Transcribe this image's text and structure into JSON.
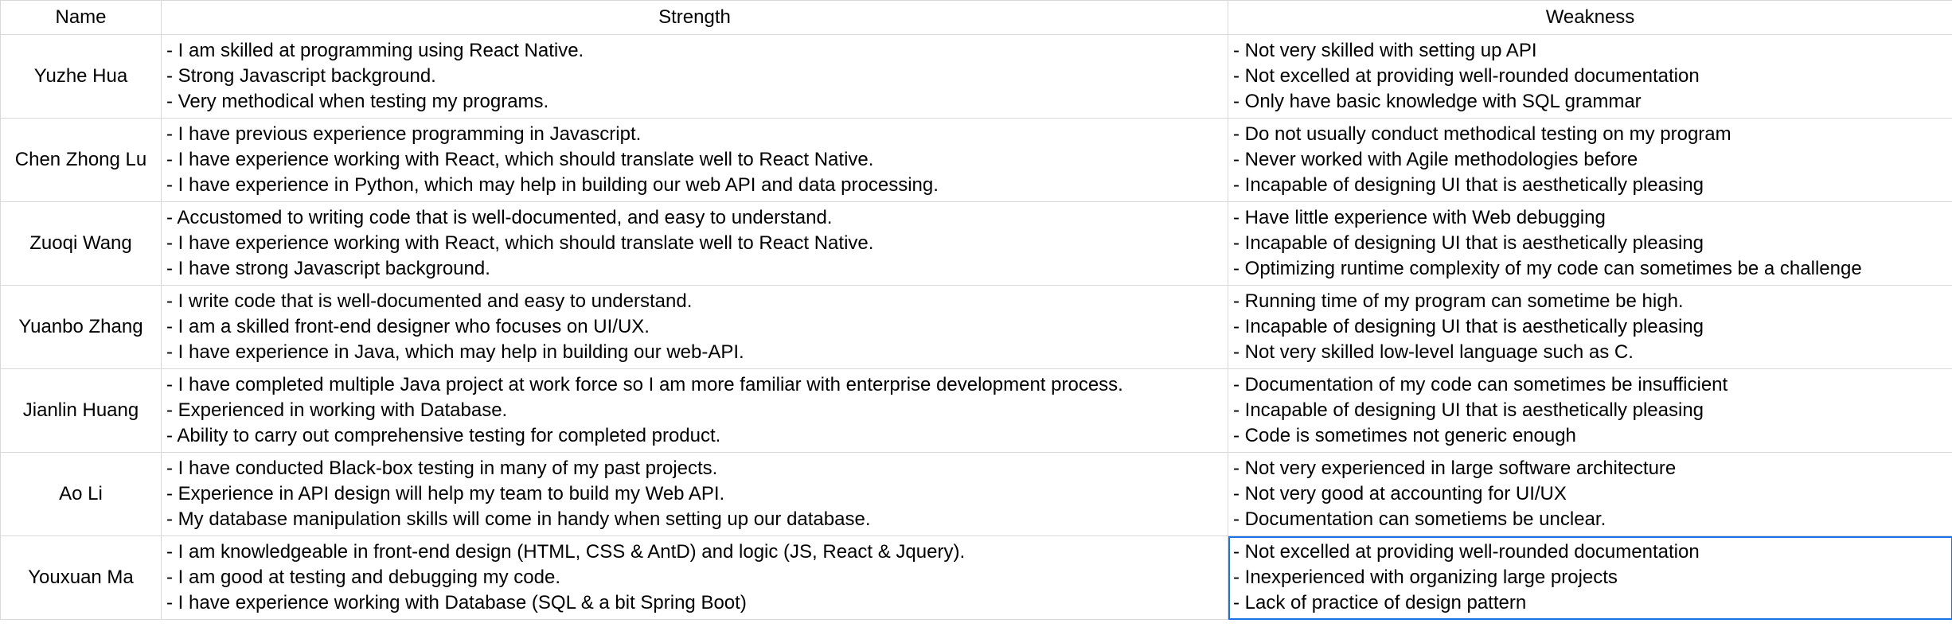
{
  "header": {
    "name": "Name",
    "strength": "Strength",
    "weakness": "Weakness"
  },
  "rows": [
    {
      "name": "Yuzhe Hua",
      "strength": [
        "- I am skilled at programming using React Native.",
        "- Strong Javascript background.",
        "- Very methodical when testing my programs."
      ],
      "weakness": [
        "- Not very skilled with setting up API",
        "- Not excelled at providing well-rounded documentation",
        "- Only have basic knowledge with SQL grammar"
      ]
    },
    {
      "name": "Chen Zhong Lu",
      "strength": [
        "- I have previous experience programming in Javascript.",
        "- I have experience working with React, which should translate well to React Native.",
        "- I have experience in Python, which may help in building our web API and data processing."
      ],
      "weakness": [
        "- Do not usually conduct methodical testing on my program",
        "- Never worked with Agile methodologies before",
        "- Incapable of designing UI that is aesthetically pleasing"
      ]
    },
    {
      "name": "Zuoqi Wang",
      "strength": [
        "- Accustomed to writing code that is well-documented, and easy to understand.",
        "- I have experience working with React, which should translate well to React Native.",
        "- I have strong Javascript background."
      ],
      "weakness": [
        "- Have little experience with Web debugging",
        "- Incapable of designing UI that is aesthetically pleasing",
        "- Optimizing runtime complexity of my code can sometimes be a challenge"
      ]
    },
    {
      "name": "Yuanbo Zhang",
      "strength": [
        "- I write code that is well-documented and easy to understand.",
        "- I am a skilled front-end designer who focuses on UI/UX.",
        "- I have experience in Java, which may help in building our web-API."
      ],
      "weakness": [
        "- Running time of my program can sometime be high.",
        "- Incapable of designing UI that is aesthetically pleasing",
        "- Not very skilled low-level language such as C."
      ]
    },
    {
      "name": "Jianlin Huang",
      "strength": [
        "- I have completed multiple Java project at work force so I am more familiar with enterprise development process.",
        "- Experienced in working with Database.",
        "- Ability to carry out comprehensive testing for completed product."
      ],
      "weakness": [
        "- Documentation of my code can sometimes be insufficient",
        "- Incapable of designing UI that is aesthetically pleasing",
        "- Code is sometimes not generic enough"
      ]
    },
    {
      "name": "Ao Li",
      "strength": [
        "- I have conducted Black-box testing in many of my past projects.",
        "- Experience in API design will help my team to build my Web API.",
        "- My database manipulation skills will come in handy when setting up our database."
      ],
      "weakness": [
        "- Not very experienced in large software architecture",
        "- Not very good at accounting for UI/UX",
        "- Documentation can sometiems be unclear."
      ]
    },
    {
      "name": "Youxuan Ma",
      "strength": [
        "- I am knowledgeable in front-end design (HTML, CSS & AntD) and logic (JS, React & Jquery).",
        "- I am good at testing and debugging my code.",
        "- I have experience working with Database (SQL & a bit Spring Boot)"
      ],
      "weakness": [
        "- Not excelled at providing well-rounded documentation",
        "- Inexperienced with organizing large projects",
        "- Lack of practice of design pattern"
      ]
    }
  ],
  "selection_color": "#1a73e8",
  "grid_color": "#d9d9d9"
}
